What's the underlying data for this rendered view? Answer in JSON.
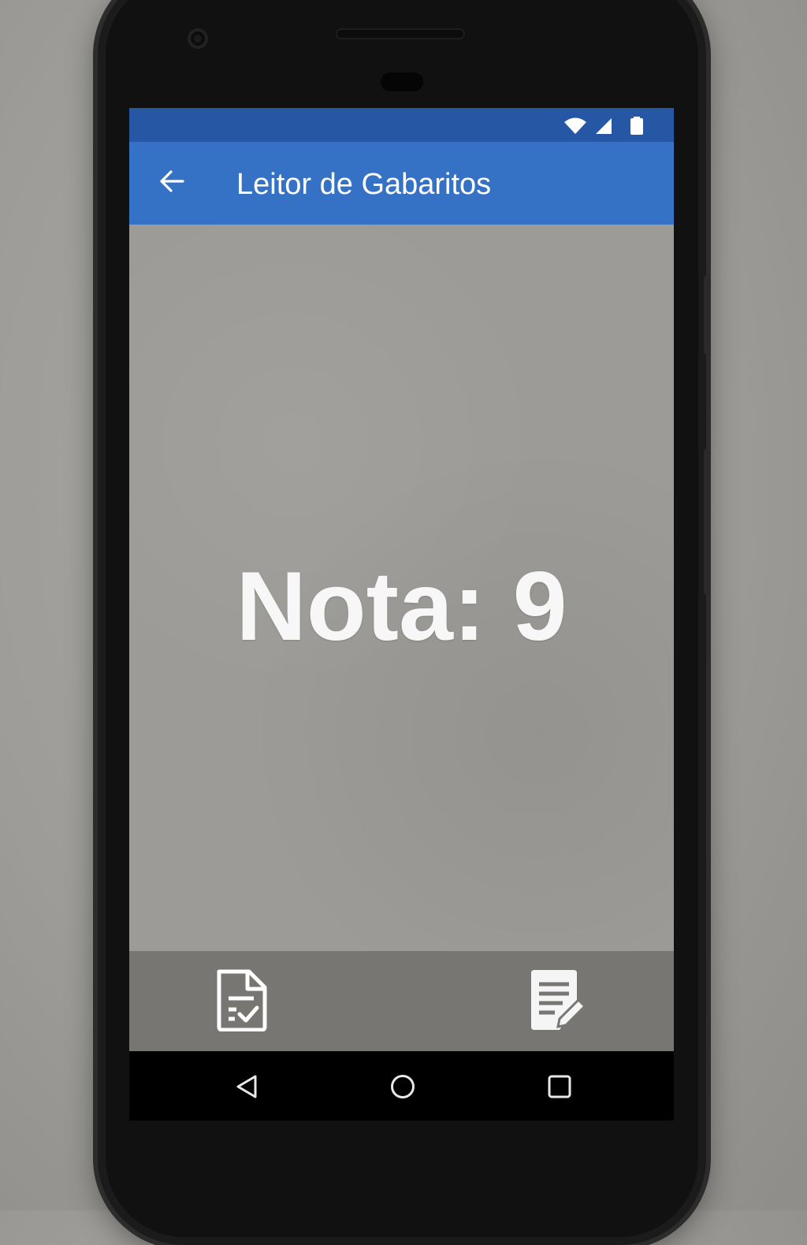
{
  "app_bar": {
    "title": "Leitor de Gabaritos",
    "back_icon": "arrow-back-icon",
    "background_color": "#3572c5"
  },
  "status_bar": {
    "background_color": "#2657a4",
    "icons": [
      "wifi-icon",
      "cellular-signal-icon",
      "battery-icon"
    ]
  },
  "result": {
    "score_text": "Nota: 9"
  },
  "bottom_actions": [
    {
      "icon": "answer-sheet-check-icon"
    },
    {
      "icon": "edit-document-icon"
    }
  ],
  "navigation": {
    "icons": [
      "nav-back-icon",
      "nav-home-icon",
      "nav-recents-icon"
    ]
  }
}
